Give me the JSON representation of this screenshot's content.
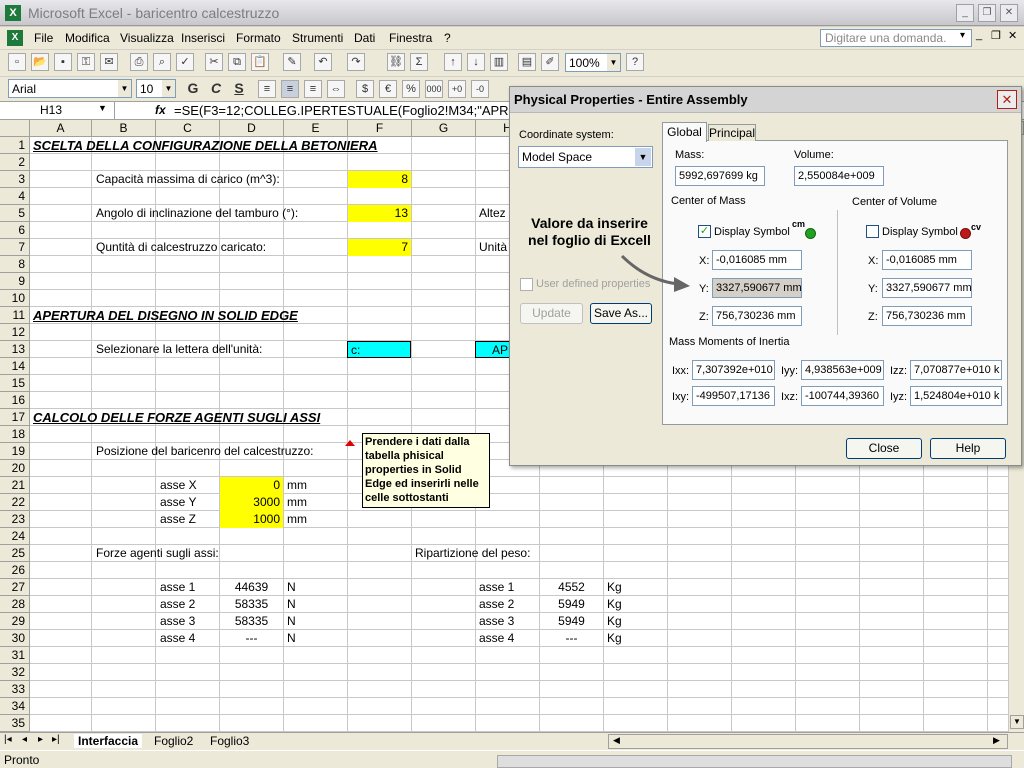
{
  "window": {
    "title": "Microsoft Excel - baricentro calcestruzzo"
  },
  "menu": {
    "items": [
      "File",
      "Modifica",
      "Visualizza",
      "Inserisci",
      "Formato",
      "Strumenti",
      "Dati",
      "Finestra",
      "?"
    ],
    "ask_placeholder": "Digitare una domanda."
  },
  "toolbar": {
    "zoom": "100%",
    "font": "Arial",
    "font_size": "10",
    "bold": "G",
    "italic": "C",
    "underline": "S",
    "sigma": "Σ",
    "euro": "€",
    "percent": "%",
    "thousands": "000"
  },
  "formula_bar": {
    "name_box": "H13",
    "fx": "fx",
    "formula": "=SE(F3=12;COLLEG.IPERTESTUALE(Foglio2!M34;\"APR"
  },
  "columns": [
    "A",
    "B",
    "C",
    "D",
    "E",
    "F",
    "G",
    "H"
  ],
  "rows": [
    "1",
    "2",
    "3",
    "4",
    "5",
    "6",
    "7",
    "8",
    "9",
    "10",
    "11",
    "12",
    "13",
    "14",
    "15",
    "16",
    "17",
    "18",
    "19",
    "20",
    "21",
    "22",
    "23",
    "24",
    "25",
    "26",
    "27",
    "28",
    "29",
    "30",
    "31",
    "32",
    "33",
    "34",
    "35"
  ],
  "sheet": {
    "h1": "SCELTA DELLA CONFIGURAZIONE DELLA BETONIERA",
    "cap_label": "Capacità massima di carico (m^3):",
    "cap_val": "8",
    "ang_label": "Angolo di inclinazione del tamburo (°):",
    "ang_val": "13",
    "altez": "Altez",
    "qty_label": "Quntità di calcestruzzo caricato:",
    "qty_val": "7",
    "unita": "Unità",
    "h2": "APERTURA DEL DISEGNO IN SOLID EDGE",
    "sel_label": "Selezionare la lettera dell'unità:",
    "sel_val": "c:",
    "ap": "AP",
    "h3": "CALCOLO DELLE FORZE AGENTI SUGLI ASSI",
    "pos_label": "Posizione del baricenro del calcestruzzo:",
    "axes": [
      {
        "label": "asse X",
        "value": "0",
        "unit": "mm"
      },
      {
        "label": "asse Y",
        "value": "3000",
        "unit": "mm"
      },
      {
        "label": "asse Z",
        "value": "1000",
        "unit": "mm"
      }
    ],
    "forze_label": "Forze agenti sugli assi:",
    "rip_label": "Ripartizione del peso:",
    "forces": [
      {
        "label": "asse 1",
        "value": "44639",
        "unit": "N"
      },
      {
        "label": "asse 2",
        "value": "58335",
        "unit": "N"
      },
      {
        "label": "asse 3",
        "value": "58335",
        "unit": "N"
      },
      {
        "label": "asse 4",
        "value": "---",
        "unit": "N"
      }
    ],
    "weights": [
      {
        "label": "asse 1",
        "value": "4552",
        "unit": "Kg"
      },
      {
        "label": "asse 2",
        "value": "5949",
        "unit": "Kg"
      },
      {
        "label": "asse 3",
        "value": "5949",
        "unit": "Kg"
      },
      {
        "label": "asse 4",
        "value": "---",
        "unit": "Kg"
      }
    ]
  },
  "comment": "Prendere i dati dalla tabella phisical properties in Solid Edge ed inserirli nelle celle sottostanti",
  "tabs": [
    "Interfaccia",
    "Foglio2",
    "Foglio3"
  ],
  "status": "Pronto",
  "dialog": {
    "title": "Physical Properties - Entire Assembly",
    "coord_label": "Coordinate system:",
    "coord_value": "Model Space",
    "user_defined": "User defined properties",
    "update": "Update",
    "save_as": "Save As...",
    "tab_global": "Global",
    "tab_principal": "Principal",
    "mass_label": "Mass:",
    "mass_value": "5992,697699 kg",
    "volume_label": "Volume:",
    "volume_value": "2,550084e+009",
    "com_label": "Center of Mass",
    "cov_label": "Center of Volume",
    "display_symbol": "Display Symbol",
    "cm_tag": "cm",
    "cv_tag": "cv",
    "x_label": "X:",
    "y_label": "Y:",
    "z_label": "Z:",
    "com": {
      "x": "-0,016085 mm",
      "y": "3327,590677 mm",
      "z": "756,730236 mm"
    },
    "cov": {
      "x": "-0,016085 mm",
      "y": "3327,590677 mm",
      "z": "756,730236 mm"
    },
    "inertia_label": "Mass Moments of Inertia",
    "ixx_label": "Ixx:",
    "ixx": "7,307392e+010",
    "iyy_label": "Iyy:",
    "iyy": "4,938563e+009",
    "izz_label": "Izz:",
    "izz": "7,070877e+010 k",
    "ixy_label": "Ixy:",
    "ixy": "-499507,17136",
    "ixz_label": "Ixz:",
    "ixz": "-100744,39360",
    "iyz_label": "Iyz:",
    "iyz": "1,524804e+010 k",
    "close": "Close",
    "help": "Help"
  },
  "annotation": "Valore da inserire nel foglio di Excell",
  "colors": {
    "highlight_yellow": "#ffff00",
    "highlight_cyan": "#00ffff",
    "comment_bg": "#ffffe1"
  }
}
